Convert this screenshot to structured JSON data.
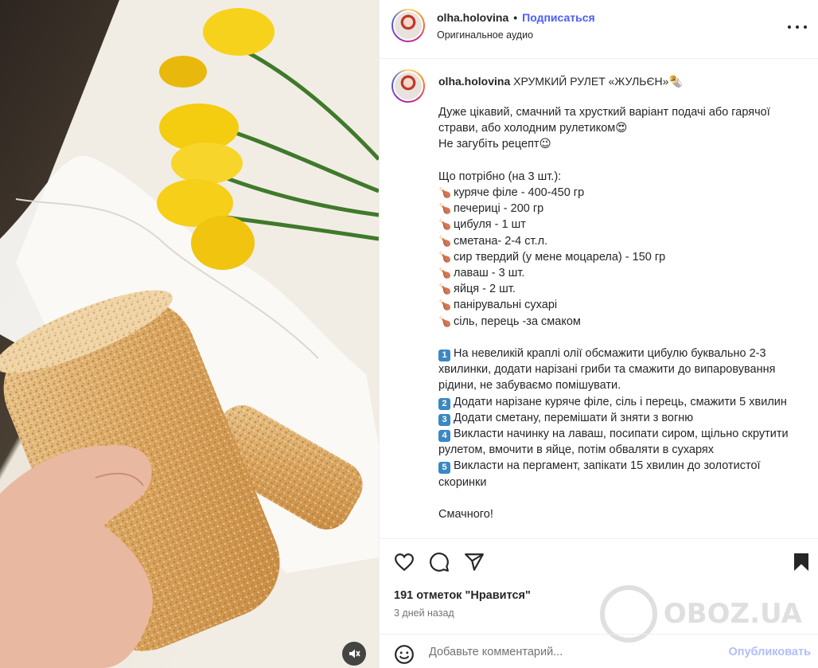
{
  "header": {
    "username": "olha.holovina",
    "dot": "•",
    "follow_label": "Подписаться",
    "audio_label": "Оригинальное аудио"
  },
  "caption": {
    "username": "olha.holovina",
    "title": "ХРУМКИЙ РУЛЕТ «ЖУЛЬЄН»",
    "title_emoji": "🌯",
    "intro_1": "Дуже цікавий, смачний та хрусткий варіант подачі або гарячої страви, або холодним рулетиком",
    "intro_1_emoji": "😍",
    "intro_2": "Не загубіть рецепт",
    "intro_2_emoji": "😉",
    "ingredients_title": "Що потрібно (на 3 шт.):",
    "ingredient_emoji": "🍗",
    "ingredients": [
      "куряче філе - 400-450 гр",
      "печериці - 200 гр",
      "цибуля - 1 шт",
      "сметана- 2-4 ст.л.",
      "сир твердий (у мене моцарела) - 150 гр",
      "лаваш - 3 шт.",
      "яйця - 2 шт.",
      "панірувальні сухарі",
      "сіль, перець -за смаком"
    ],
    "steps": [
      {
        "num": "1",
        "text": "На невеликій краплі олії обсмажити цибулю буквально 2-3 хвилинки, додати нарізані гриби та смажити до випаровування рідини, не забуваємо помішувати."
      },
      {
        "num": "2",
        "text": "Додати нарізане куряче філе, сіль і перець, смажити 5 хвилин"
      },
      {
        "num": "3",
        "text": "Додати сметану, перемішати й зняти з вогню"
      },
      {
        "num": "4",
        "text": "Викласти начинку на лаваш, посипати сиром, щільно скрутити рулетом, вмочити в яйце, потім обваляти в сухарях"
      },
      {
        "num": "5",
        "text": "Викласти на пергамент, запікати 15 хвилин до золотистої скоринки"
      }
    ],
    "closing": "Смачного!"
  },
  "actions": {
    "likes_text": "191 отметок \"Нравится\"",
    "date_text": "3 дней назад"
  },
  "comment": {
    "placeholder": "Добавьте комментарий...",
    "post_label": "Опубликовать"
  },
  "watermark": "OBOZ.UA",
  "icons": [
    "heart-icon",
    "comment-icon",
    "share-icon",
    "bookmark-icon",
    "emoji-icon",
    "more-icon",
    "mute-icon"
  ],
  "colors": {
    "follow": "#4a5df9",
    "post_disabled": "#b3bdf7",
    "muted_text": "#737373"
  }
}
